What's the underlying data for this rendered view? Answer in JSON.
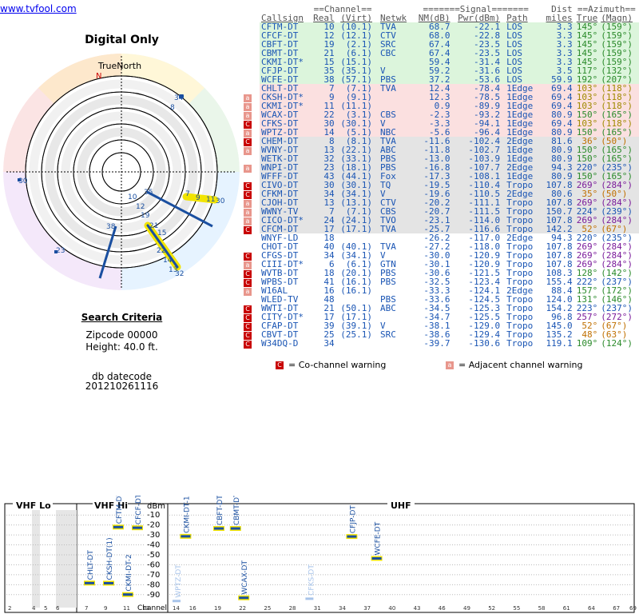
{
  "page": {
    "title": "Digital Only",
    "true_north_label": "TrueNorth",
    "north_marker": "N",
    "link": "www.tvfool.com"
  },
  "criteria": {
    "title": "Search Criteria",
    "zipcode": "Zipcode 00000",
    "height": "Height: 40.0 ft.",
    "dbdate_label": "db datecode",
    "dbdate": "201210261116"
  },
  "polar": {
    "ring_labels": [
      "8",
      "34",
      "30",
      "10",
      "35",
      "7",
      "9",
      "11",
      "30",
      "12",
      "19",
      "21",
      "15",
      "38",
      "23",
      "22",
      "14",
      "13",
      "32"
    ]
  },
  "table": {
    "header_groups": [
      "==Channel==",
      "=======Signal=======",
      "Dist",
      "==Azimuth=="
    ],
    "columns": [
      "Callsign",
      "Real",
      "(Virt)",
      "Netwk",
      "NM(dB)",
      "Pwr(dBm)",
      "Path",
      "miles",
      "True",
      "(Magn)"
    ],
    "rows": [
      {
        "call": "CFTM-DT",
        "real": "10",
        "virt": "(10.1)",
        "net": "TVA",
        "nm": "68.7",
        "pwr": "-22.1",
        "path": "LOS",
        "dist": "3.3",
        "az": "145°",
        "mag": "(159°)",
        "bg": "#dcf5dc",
        "azc": "#2a8a2a",
        "flag": ""
      },
      {
        "call": "CFCF-DT",
        "real": "12",
        "virt": "(12.1)",
        "net": "CTV",
        "nm": "68.0",
        "pwr": "-22.8",
        "path": "LOS",
        "dist": "3.3",
        "az": "145°",
        "mag": "(159°)",
        "bg": "#dcf5dc",
        "azc": "#2a8a2a",
        "flag": ""
      },
      {
        "call": "CBFT-DT",
        "real": "19",
        "virt": "(2.1)",
        "net": "SRC",
        "nm": "67.4",
        "pwr": "-23.5",
        "path": "LOS",
        "dist": "3.3",
        "az": "145°",
        "mag": "(159°)",
        "bg": "#dcf5dc",
        "azc": "#2a8a2a",
        "flag": ""
      },
      {
        "call": "CBMT-DT",
        "real": "21",
        "virt": "(6.1)",
        "net": "CBC",
        "nm": "67.4",
        "pwr": "-23.5",
        "path": "LOS",
        "dist": "3.3",
        "az": "145°",
        "mag": "(159°)",
        "bg": "#dcf5dc",
        "azc": "#2a8a2a",
        "flag": ""
      },
      {
        "call": "CKMI-DT*",
        "real": "15",
        "virt": "(15.1)",
        "net": "",
        "nm": "59.4",
        "pwr": "-31.4",
        "path": "LOS",
        "dist": "3.3",
        "az": "145°",
        "mag": "(159°)",
        "bg": "#dcf5dc",
        "azc": "#2a8a2a",
        "flag": ""
      },
      {
        "call": "CFJP-DT",
        "real": "35",
        "virt": "(35.1)",
        "net": "V",
        "nm": "59.2",
        "pwr": "-31.6",
        "path": "LOS",
        "dist": "3.5",
        "az": "117°",
        "mag": "(132°)",
        "bg": "#dcf5dc",
        "azc": "#2a8a2a",
        "flag": ""
      },
      {
        "call": "WCFE-DT",
        "real": "38",
        "virt": "(57.1)",
        "net": "PBS",
        "nm": "37.2",
        "pwr": "-53.6",
        "path": "LOS",
        "dist": "59.9",
        "az": "192°",
        "mag": "(207°)",
        "bg": "#dcf5dc",
        "azc": "#2a8a2a",
        "flag": ""
      },
      {
        "call": "CHLT-DT",
        "real": "7",
        "virt": "(7.1)",
        "net": "TVA",
        "nm": "12.4",
        "pwr": "-78.4",
        "path": "1Edge",
        "dist": "69.4",
        "az": "103°",
        "mag": "(118°)",
        "bg": "#fbe0e0",
        "azc": "#a08a00",
        "flag": ""
      },
      {
        "call": "CKSH-DT*",
        "real": "9",
        "virt": "(9.1)",
        "net": "",
        "nm": "12.3",
        "pwr": "-78.5",
        "path": "1Edge",
        "dist": "69.4",
        "az": "103°",
        "mag": "(118°)",
        "bg": "#fbe0e0",
        "azc": "#a08a00",
        "flag": "a"
      },
      {
        "call": "CKMI-DT*",
        "real": "11",
        "virt": "(11.1)",
        "net": "",
        "nm": "0.9",
        "pwr": "-89.9",
        "path": "1Edge",
        "dist": "69.4",
        "az": "103°",
        "mag": "(118°)",
        "bg": "#fbe0e0",
        "azc": "#a08a00",
        "flag": "a"
      },
      {
        "call": "WCAX-DT",
        "real": "22",
        "virt": "(3.1)",
        "net": "CBS",
        "nm": "-2.3",
        "pwr": "-93.2",
        "path": "1Edge",
        "dist": "80.9",
        "az": "150°",
        "mag": "(165°)",
        "bg": "#fbe0e0",
        "azc": "#2a8a2a",
        "flag": "a"
      },
      {
        "call": "CFKS-DT",
        "real": "30",
        "virt": "(30.1)",
        "net": "V",
        "nm": "-3.3",
        "pwr": "-94.1",
        "path": "1Edge",
        "dist": "69.4",
        "az": "103°",
        "mag": "(118°)",
        "bg": "#fbe0e0",
        "azc": "#a08a00",
        "flag": "c"
      },
      {
        "call": "WPTZ-DT",
        "real": "14",
        "virt": "(5.1)",
        "net": "NBC",
        "nm": "-5.6",
        "pwr": "-96.4",
        "path": "1Edge",
        "dist": "80.9",
        "az": "150°",
        "mag": "(165°)",
        "bg": "#fbe0e0",
        "azc": "#2a8a2a",
        "flag": "a"
      },
      {
        "call": "CHEM-DT",
        "real": "8",
        "virt": "(8.1)",
        "net": "TVA",
        "nm": "-11.6",
        "pwr": "-102.4",
        "path": "2Edge",
        "dist": "81.6",
        "az": "36°",
        "mag": "(50°)",
        "bg": "#e4e4e4",
        "azc": "#c07000",
        "flag": "c"
      },
      {
        "call": "WVNY-DT",
        "real": "13",
        "virt": "(22.1)",
        "net": "ABC",
        "nm": "-11.8",
        "pwr": "-102.7",
        "path": "1Edge",
        "dist": "80.9",
        "az": "150°",
        "mag": "(165°)",
        "bg": "#e4e4e4",
        "azc": "#2a8a2a",
        "flag": "a"
      },
      {
        "call": "WETK-DT",
        "real": "32",
        "virt": "(33.1)",
        "net": "PBS",
        "nm": "-13.0",
        "pwr": "-103.9",
        "path": "1Edge",
        "dist": "80.9",
        "az": "150°",
        "mag": "(165°)",
        "bg": "#e4e4e4",
        "azc": "#2a8a2a",
        "flag": ""
      },
      {
        "call": "WNPI-DT",
        "real": "23",
        "virt": "(18.1)",
        "net": "PBS",
        "nm": "-16.8",
        "pwr": "-107.7",
        "path": "2Edge",
        "dist": "94.3",
        "az": "220°",
        "mag": "(235°)",
        "bg": "#e4e4e4",
        "azc": "#1a55b4",
        "flag": "a"
      },
      {
        "call": "WFFF-DT",
        "real": "43",
        "virt": "(44.1)",
        "net": "Fox",
        "nm": "-17.3",
        "pwr": "-108.1",
        "path": "1Edge",
        "dist": "80.9",
        "az": "150°",
        "mag": "(165°)",
        "bg": "#e4e4e4",
        "azc": "#2a8a2a",
        "flag": ""
      },
      {
        "call": "CIVO-DT",
        "real": "30",
        "virt": "(30.1)",
        "net": "TQ",
        "nm": "-19.5",
        "pwr": "-110.4",
        "path": "Tropo",
        "dist": "107.8",
        "az": "269°",
        "mag": "(284°)",
        "bg": "#e4e4e4",
        "azc": "#7a1a9a",
        "flag": "c"
      },
      {
        "call": "CFKM-DT",
        "real": "34",
        "virt": "(34.1)",
        "net": "V",
        "nm": "-19.6",
        "pwr": "-110.5",
        "path": "2Edge",
        "dist": "80.6",
        "az": "35°",
        "mag": "(50°)",
        "bg": "#e4e4e4",
        "azc": "#c07000",
        "flag": "c"
      },
      {
        "call": "CJOH-DT",
        "real": "13",
        "virt": "(13.1)",
        "net": "CTV",
        "nm": "-20.2",
        "pwr": "-111.1",
        "path": "Tropo",
        "dist": "107.8",
        "az": "269°",
        "mag": "(284°)",
        "bg": "#e4e4e4",
        "azc": "#7a1a9a",
        "flag": "a"
      },
      {
        "call": "WWNY-TV",
        "real": "7",
        "virt": "(7.1)",
        "net": "CBS",
        "nm": "-20.7",
        "pwr": "-111.5",
        "path": "Tropo",
        "dist": "150.7",
        "az": "224°",
        "mag": "(239°)",
        "bg": "#e4e4e4",
        "azc": "#1a55b4",
        "flag": "a"
      },
      {
        "call": "CICO-DT*",
        "real": "24",
        "virt": "(24.1)",
        "net": "TVO",
        "nm": "-23.1",
        "pwr": "-114.0",
        "path": "Tropo",
        "dist": "107.8",
        "az": "269°",
        "mag": "(284°)",
        "bg": "#e4e4e4",
        "azc": "#7a1a9a",
        "flag": "a"
      },
      {
        "call": "CFCM-DT",
        "real": "17",
        "virt": "(17.1)",
        "net": "TVA",
        "nm": "-25.7",
        "pwr": "-116.6",
        "path": "Tropo",
        "dist": "142.2",
        "az": "52°",
        "mag": "(67°)",
        "bg": "#e4e4e4",
        "azc": "#c07000",
        "flag": "c"
      },
      {
        "call": "WNYF-LD",
        "real": "18",
        "virt": "",
        "net": "",
        "nm": "-26.2",
        "pwr": "-117.0",
        "path": "2Edge",
        "dist": "94.3",
        "az": "220°",
        "mag": "(235°)",
        "bg": "#ffffff",
        "azc": "#1a55b4",
        "flag": ""
      },
      {
        "call": "CHOT-DT",
        "real": "40",
        "virt": "(40.1)",
        "net": "TVA",
        "nm": "-27.2",
        "pwr": "-118.0",
        "path": "Tropo",
        "dist": "107.8",
        "az": "269°",
        "mag": "(284°)",
        "bg": "#ffffff",
        "azc": "#7a1a9a",
        "flag": ""
      },
      {
        "call": "CFGS-DT",
        "real": "34",
        "virt": "(34.1)",
        "net": "V",
        "nm": "-30.0",
        "pwr": "-120.9",
        "path": "Tropo",
        "dist": "107.8",
        "az": "269°",
        "mag": "(284°)",
        "bg": "#ffffff",
        "azc": "#7a1a9a",
        "flag": "c"
      },
      {
        "call": "CIII-DT*",
        "real": "6",
        "virt": "(6.1)",
        "net": "GTN",
        "nm": "-30.1",
        "pwr": "-120.9",
        "path": "Tropo",
        "dist": "107.8",
        "az": "269°",
        "mag": "(284°)",
        "bg": "#ffffff",
        "azc": "#7a1a9a",
        "flag": "a"
      },
      {
        "call": "WVTB-DT",
        "real": "18",
        "virt": "(20.1)",
        "net": "PBS",
        "nm": "-30.6",
        "pwr": "-121.5",
        "path": "Tropo",
        "dist": "108.3",
        "az": "128°",
        "mag": "(142°)",
        "bg": "#ffffff",
        "azc": "#2a8a2a",
        "flag": "c"
      },
      {
        "call": "WPBS-DT",
        "real": "41",
        "virt": "(16.1)",
        "net": "PBS",
        "nm": "-32.5",
        "pwr": "-123.4",
        "path": "Tropo",
        "dist": "155.4",
        "az": "222°",
        "mag": "(237°)",
        "bg": "#ffffff",
        "azc": "#1a55b4",
        "flag": "c"
      },
      {
        "call": "W16AL",
        "real": "16",
        "virt": "(16.1)",
        "net": "",
        "nm": "-33.3",
        "pwr": "-124.1",
        "path": "2Edge",
        "dist": "88.4",
        "az": "157°",
        "mag": "(172°)",
        "bg": "#ffffff",
        "azc": "#2a8a2a",
        "flag": "a"
      },
      {
        "call": "WLED-TV",
        "real": "48",
        "virt": "",
        "net": "PBS",
        "nm": "-33.6",
        "pwr": "-124.5",
        "path": "Tropo",
        "dist": "124.0",
        "az": "131°",
        "mag": "(146°)",
        "bg": "#ffffff",
        "azc": "#2a8a2a",
        "flag": ""
      },
      {
        "call": "WWTI-DT",
        "real": "21",
        "virt": "(50.1)",
        "net": "ABC",
        "nm": "-34.5",
        "pwr": "-125.3",
        "path": "Tropo",
        "dist": "154.2",
        "az": "223°",
        "mag": "(237°)",
        "bg": "#ffffff",
        "azc": "#1a55b4",
        "flag": "c"
      },
      {
        "call": "CITY-DT*",
        "real": "17",
        "virt": "(17.1)",
        "net": "",
        "nm": "-34.7",
        "pwr": "-125.5",
        "path": "Tropo",
        "dist": "96.8",
        "az": "257°",
        "mag": "(272°)",
        "bg": "#ffffff",
        "azc": "#7a1a9a",
        "flag": "c"
      },
      {
        "call": "CFAP-DT",
        "real": "39",
        "virt": "(39.1)",
        "net": "V",
        "nm": "-38.1",
        "pwr": "-129.0",
        "path": "Tropo",
        "dist": "145.0",
        "az": "52°",
        "mag": "(67°)",
        "bg": "#ffffff",
        "azc": "#c07000",
        "flag": "c"
      },
      {
        "call": "CBVT-DT",
        "real": "25",
        "virt": "(25.1)",
        "net": "SRC",
        "nm": "-38.6",
        "pwr": "-129.4",
        "path": "Tropo",
        "dist": "135.2",
        "az": "48°",
        "mag": "(63°)",
        "bg": "#ffffff",
        "azc": "#c07000",
        "flag": "c"
      },
      {
        "call": "W34DQ-D",
        "real": "34",
        "virt": "",
        "net": "",
        "nm": "-39.7",
        "pwr": "-130.6",
        "path": "Tropo",
        "dist": "119.1",
        "az": "109°",
        "mag": "(124°)",
        "bg": "#ffffff",
        "azc": "#2a8a2a",
        "flag": "c"
      }
    ]
  },
  "legend": {
    "co_flag": "C",
    "co_label": "= Co-channel warning",
    "adj_flag": "a",
    "adj_label": "= Adjacent channel warning",
    "co_color": "#c80000",
    "adj_color": "#e8968c"
  },
  "spectrum": {
    "sections": [
      "VHF Lo",
      "VHF Hi",
      "UHF"
    ],
    "y_unit": "dBm",
    "y_ticks": [
      "-10",
      "-20",
      "-30",
      "-40",
      "-50",
      "-60",
      "-70",
      "-80",
      "-90"
    ],
    "channel_label": "Channel",
    "channel_ticks": [
      "2",
      "4",
      "5",
      "6",
      "7",
      "9",
      "11",
      "13",
      "14",
      "16",
      "19",
      "22",
      "25",
      "28",
      "31",
      "34",
      "37",
      "40",
      "43",
      "46",
      "49",
      "52",
      "55",
      "58",
      "61",
      "64",
      "67",
      "69"
    ],
    "stations": [
      {
        "call": "CFTM-DT",
        "ch": 10,
        "dbm": -22.1,
        "strong": true
      },
      {
        "call": "CFCF-DT",
        "ch": 12,
        "dbm": -22.8,
        "strong": true
      },
      {
        "call": "CHLT-DT",
        "ch": 7,
        "dbm": -78.4,
        "strong": true
      },
      {
        "call": "CKSH-DT(1)",
        "ch": 9,
        "dbm": -78.5,
        "strong": true
      },
      {
        "call": "CKMI-DT-2",
        "ch": 11,
        "dbm": -89.9,
        "strong": true
      },
      {
        "call": "CKMI-DT-1",
        "ch": 15,
        "dbm": -31.4,
        "strong": true
      },
      {
        "call": "CBFT-DT",
        "ch": 19,
        "dbm": -23.5,
        "strong": true
      },
      {
        "call": "CBMT-DT",
        "ch": 21,
        "dbm": -23.5,
        "strong": true
      },
      {
        "call": "WCAX-DT",
        "ch": 22,
        "dbm": -93.2,
        "strong": true
      },
      {
        "call": "WPTZ-DT",
        "ch": 14,
        "dbm": -96.4,
        "strong": false
      },
      {
        "call": "CFKS-DT",
        "ch": 30,
        "dbm": -94.1,
        "strong": false
      },
      {
        "call": "CFJP-DT",
        "ch": 35,
        "dbm": -31.6,
        "strong": true
      },
      {
        "call": "WCFE-DT",
        "ch": 38,
        "dbm": -53.6,
        "strong": true
      }
    ]
  }
}
